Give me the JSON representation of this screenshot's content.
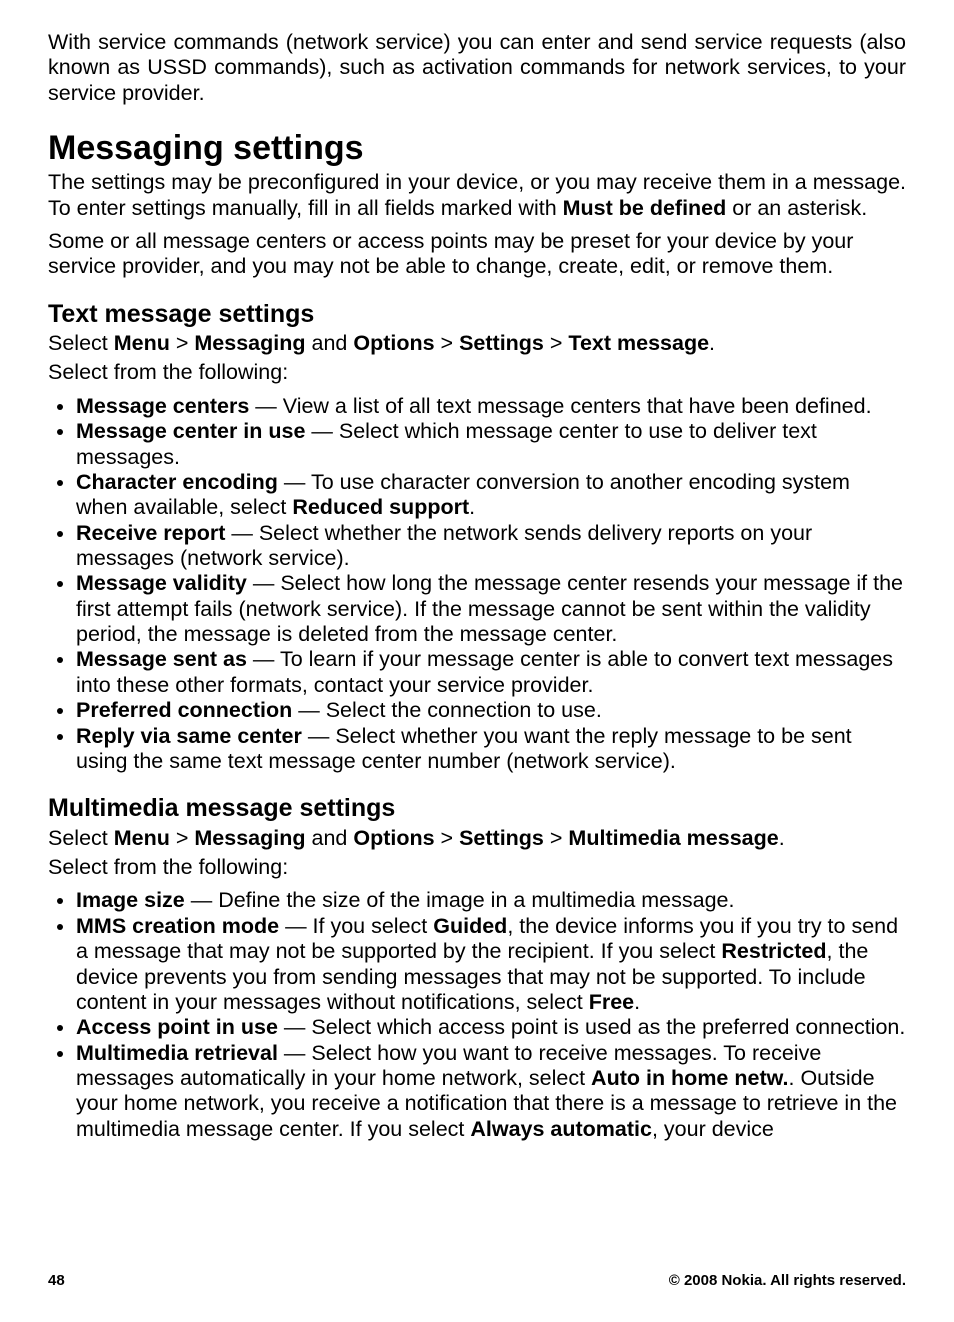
{
  "intro": "With service commands (network service) you can enter and send service requests (also known as USSD commands), such as activation commands for network services, to your service provider.",
  "h1": "Messaging settings",
  "p1_a": "The settings may be preconfigured in your device, or you may receive them in a message. To enter settings manually, fill in all fields marked with ",
  "p1_b_bold": "Must be defined",
  "p1_c": " or an asterisk.",
  "p2": "Some or all message centers or access points may be preset for your device by your service provider, and you may not be able to change, create, edit, or remove them.",
  "text_msg": {
    "heading": "Text message settings",
    "select_prefix": "Select ",
    "path": [
      "Menu",
      " > ",
      "Messaging",
      " and ",
      "Options",
      " > ",
      "Settings",
      " > ",
      "Text message",
      "."
    ],
    "follow": "Select from the following:",
    "items": [
      {
        "term": "Message centers",
        "desc": " — View a list of all text message centers that have been defined."
      },
      {
        "term": "Message center in use",
        "desc": " — Select which message center to use to deliver text messages."
      },
      {
        "term": "Character encoding",
        "desc_a": " — To use character conversion to another encoding system when available, select ",
        "bold_in": "Reduced support",
        "desc_b": "."
      },
      {
        "term": "Receive report",
        "desc": " — Select whether the network sends delivery reports on your messages (network service)."
      },
      {
        "term": "Message validity",
        "desc": " — Select how long the message center resends your message if the first attempt fails (network service). If the message cannot be sent within the validity period, the message is deleted from the message center."
      },
      {
        "term": "Message sent as",
        "desc": " — To learn if your message center is able to convert text messages into these other formats, contact your service provider."
      },
      {
        "term": "Preferred connection",
        "desc": " — Select the connection to use."
      },
      {
        "term": "Reply via same center",
        "desc": " — Select whether you want the reply message to be sent using the same text message center number (network service)."
      }
    ]
  },
  "mms": {
    "heading": "Multimedia message settings",
    "select_prefix": "Select ",
    "path": [
      "Menu",
      " > ",
      "Messaging",
      " and ",
      "Options",
      " > ",
      "Settings",
      " > ",
      "Multimedia message",
      "."
    ],
    "follow": "Select from the following:",
    "items": [
      {
        "term": "Image size",
        "desc": " — Define the size of the image in a multimedia message."
      },
      {
        "term": "MMS creation mode",
        "parts": [
          {
            "t": " — If you select "
          },
          {
            "b": "Guided"
          },
          {
            "t": ", the device informs you if you try to send a message that may not be supported by the recipient. If you select "
          },
          {
            "b": "Restricted"
          },
          {
            "t": ", the device prevents you from sending messages that may not be supported. To include content in your messages without notifications, select "
          },
          {
            "b": "Free"
          },
          {
            "t": "."
          }
        ]
      },
      {
        "term": "Access point in use",
        "desc": " — Select which access point is used as the preferred connection."
      },
      {
        "term": "Multimedia retrieval",
        "parts": [
          {
            "t": " — Select how you want to receive messages. To receive messages automatically in your home network, select "
          },
          {
            "b": "Auto in home netw."
          },
          {
            "t": ". Outside your home network, you receive a notification that there is a message to retrieve in the multimedia message center. If you select "
          },
          {
            "b": "Always automatic"
          },
          {
            "t": ", your device"
          }
        ]
      }
    ]
  },
  "footer": {
    "page": "48",
    "copyright": "© 2008 Nokia. All rights reserved."
  }
}
